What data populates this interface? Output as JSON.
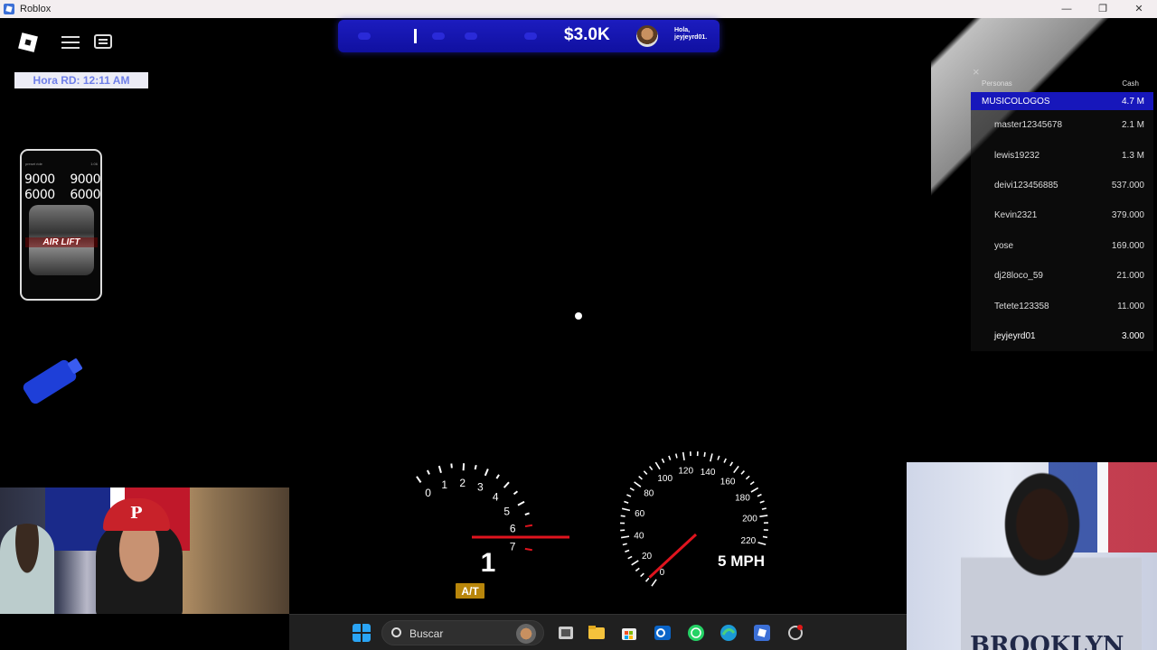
{
  "window": {
    "title": "Roblox",
    "controls": [
      "—",
      "❐",
      "✕"
    ]
  },
  "hud": {
    "clock": "Hora RD: 12:11 AM",
    "money": "$3.0K",
    "greeting_line1": "Hola,",
    "greeting_line2": "jeyjeyrd01."
  },
  "phone": {
    "status_left": "preset ride",
    "status_right": "1:06",
    "values": [
      "9000",
      "9000",
      "6000",
      "6000"
    ],
    "brand": "AIR LIFT"
  },
  "leaderboard": {
    "col_name": "Personas",
    "col_cash": "Cash",
    "team": {
      "name": "MUSICOLOGOS",
      "cash": "4.7 M"
    },
    "players": [
      {
        "name": "master12345678",
        "cash": "2.1 M"
      },
      {
        "name": "lewis19232",
        "cash": "1.3 M"
      },
      {
        "name": "deivi123456885",
        "cash": "537.000"
      },
      {
        "name": "Kevin2321",
        "cash": "379.000"
      },
      {
        "name": "yose",
        "cash": "169.000"
      },
      {
        "name": "dj28loco_59",
        "cash": "21.000"
      },
      {
        "name": "Tetete123358",
        "cash": "11.000"
      },
      {
        "name": "jeyjeyrd01",
        "cash": "3.000"
      }
    ]
  },
  "tachometer": {
    "labels": [
      "0",
      "1",
      "2",
      "3",
      "4",
      "5",
      "6",
      "7"
    ],
    "gear": "1",
    "mode": "A/T",
    "needle_value": 1.8,
    "redline_start": 6
  },
  "speedometer": {
    "labels": [
      "0",
      "20",
      "40",
      "60",
      "80",
      "100",
      "120",
      "140",
      "160",
      "180",
      "200",
      "220"
    ],
    "speed_text": "5 MPH",
    "needle_value": 5
  },
  "webcams": {
    "left_cap_letter": "P",
    "right_shirt_text": "BROOKLYN"
  },
  "taskbar": {
    "search_label": "Buscar",
    "apps": [
      "windows-start",
      "file-explorer",
      "folder",
      "store",
      "outlook",
      "whatsapp",
      "edge",
      "roblox",
      "settings"
    ]
  },
  "colors": {
    "topbar": "#1010a0",
    "team_highlight": "#1717bb",
    "redline": "#e0141e",
    "clock_text": "#6f7fe8"
  }
}
